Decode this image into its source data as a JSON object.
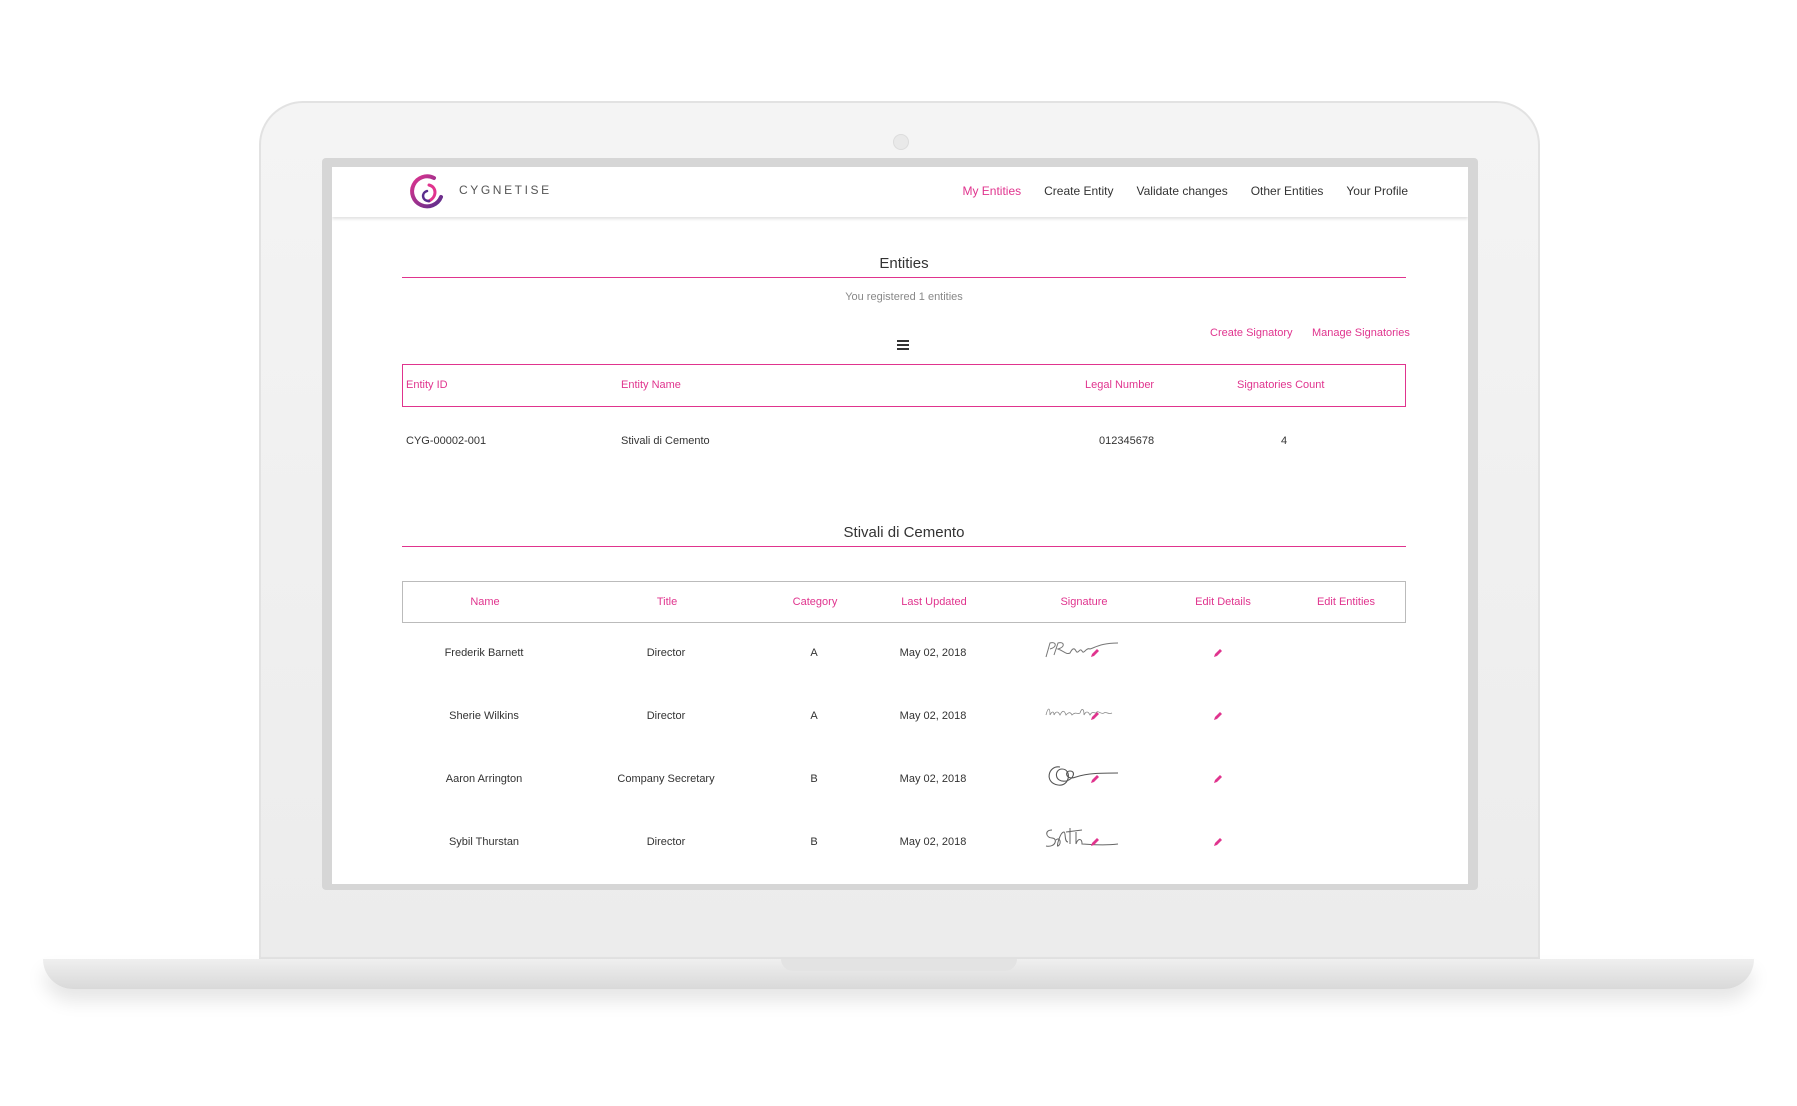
{
  "brand": {
    "name": "CYGNETISE"
  },
  "nav": [
    {
      "label": "My Entities",
      "active": true
    },
    {
      "label": "Create Entity",
      "active": false
    },
    {
      "label": "Validate changes",
      "active": false
    },
    {
      "label": "Other Entities",
      "active": false
    },
    {
      "label": "Your Profile",
      "active": false
    }
  ],
  "entities": {
    "title": "Entities",
    "subtitle": "You registered 1 entities",
    "menu_icon": "hamburger-icon",
    "actions": {
      "create_signatory": "Create Signatory",
      "manage_signatories": "Manage Signatories"
    },
    "columns": [
      "Entity ID",
      "Entity Name",
      "Legal Number",
      "Signatories Count"
    ],
    "rows": [
      {
        "id": "CYG-00002-001",
        "name": "Stivali di Cemento",
        "legal_number": "012345678",
        "signatories_count": "4"
      }
    ]
  },
  "signatories": {
    "title": "Stivali di Cemento",
    "columns": [
      "Name",
      "Title",
      "Category",
      "Last Updated",
      "Signature",
      "Edit Details",
      "Edit Entities"
    ],
    "edit_icon": "pencil-icon",
    "rows": [
      {
        "name": "Frederik Barnett",
        "title": "Director",
        "category": "A",
        "last_updated": "May 02, 2018"
      },
      {
        "name": "Sherie Wilkins",
        "title": "Director",
        "category": "A",
        "last_updated": "May 02, 2018"
      },
      {
        "name": "Aaron Arrington",
        "title": "Company Secretary",
        "category": "B",
        "last_updated": "May 02, 2018"
      },
      {
        "name": "Sybil Thurstan",
        "title": "Director",
        "category": "B",
        "last_updated": "May 02, 2018"
      }
    ]
  },
  "colors": {
    "accent": "#e0348e",
    "text": "#333333",
    "muted": "#888888"
  }
}
